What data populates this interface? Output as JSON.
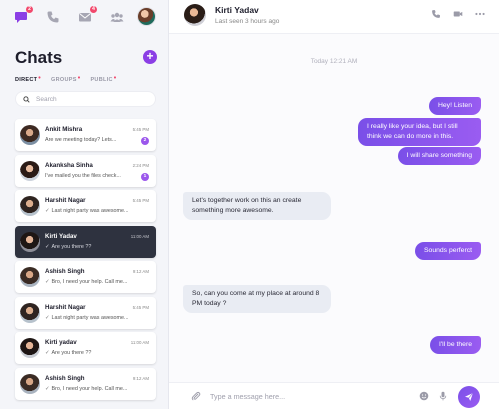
{
  "colors": {
    "accent": "#8b3ee5",
    "badge": "#f2486c",
    "active_row": "#2e323f",
    "out_bubble": "#7a4fe8",
    "in_bubble": "#e9ecf3"
  },
  "nav": {
    "icons": [
      "chat-bubble-icon",
      "phone-icon",
      "mail-icon",
      "group-icon"
    ],
    "chat_badge": "2",
    "mail_badge": "4"
  },
  "sidebar": {
    "title": "Chats",
    "add_label": "+",
    "tabs": [
      {
        "label": "DIRECT",
        "marker": "•"
      },
      {
        "label": "GROUPS",
        "marker": "•"
      },
      {
        "label": "PUBLIC",
        "marker": "•"
      }
    ],
    "search_placeholder": "Search"
  },
  "conversations": [
    {
      "name": "Ankit Mishra",
      "preview": "Are we meeting today? Lets...",
      "time": "5:45 PM",
      "badge": "2",
      "active": false
    },
    {
      "name": "Akanksha Sinha",
      "preview": "I've mailed you the files check...",
      "time": "2:24 PM",
      "badge": "1",
      "active": false
    },
    {
      "name": "Harshit Nagar",
      "preview": "Last night party was awesome...",
      "time": "5:45 PM",
      "badge": "",
      "active": false
    },
    {
      "name": "Kirti Yadav",
      "preview": "Are you there ??",
      "time": "11:00 AM",
      "badge": "",
      "active": true
    },
    {
      "name": "Ashish Singh",
      "preview": "Bro, I need your help. Call me...",
      "time": "9:12 AM",
      "badge": "",
      "active": false
    },
    {
      "name": "Harshit Nagar",
      "preview": "Last night party was awesome...",
      "time": "5:45 PM",
      "badge": "",
      "active": false
    },
    {
      "name": "Kirti yadav",
      "preview": "Are you there ??",
      "time": "11:00 AM",
      "badge": "",
      "active": false
    },
    {
      "name": "Ashish Singh",
      "preview": "Bro, I need your help. Call me...",
      "time": "9:12 AM",
      "badge": "",
      "active": false
    }
  ],
  "chat": {
    "name": "Kirti Yadav",
    "status": "Last seen 3 hours ago",
    "date_separator": "Today 12:21 AM",
    "messages": [
      {
        "dir": "out",
        "text": "Hey! Listen"
      },
      {
        "dir": "out",
        "text": "I really like your idea, but I still think we can do more in this."
      },
      {
        "dir": "out",
        "text": "I will share something"
      },
      {
        "dir": "in",
        "text": "Let's together work on this an create something more awesome."
      },
      {
        "dir": "out",
        "text": "Sounds perferct"
      },
      {
        "dir": "in",
        "text": "So, can you come at my place at around 8 PM today ?"
      },
      {
        "dir": "out",
        "text": "I'll be there"
      }
    ],
    "composer_placeholder": "Type a message here..."
  }
}
